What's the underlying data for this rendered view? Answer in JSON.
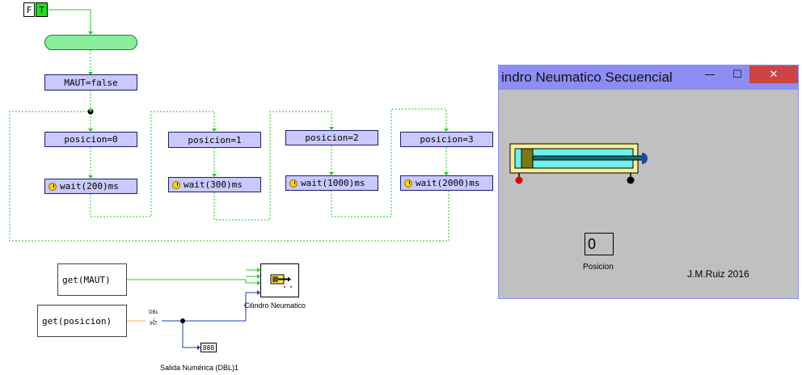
{
  "toggle": {
    "f_label": "F",
    "t_label": "T"
  },
  "flow": {
    "init_label": "MAUT=false",
    "steps": [
      {
        "set_label": "posicion=0",
        "wait_label": "wait(200)ms"
      },
      {
        "set_label": "posicion=1",
        "wait_label": "wait(300)ms"
      },
      {
        "set_label": "posicion=2",
        "wait_label": "wait(1000)ms"
      },
      {
        "set_label": "posicion=3",
        "wait_label": "wait(2000)ms"
      }
    ]
  },
  "inputs": {
    "get_maut": "get(MAUT)",
    "get_posicion": "get(posicion)",
    "converter_top": "DBL",
    "converter_bottom": "INT",
    "display_value": "888"
  },
  "labels": {
    "cylinder": "Cilindro Neumatico",
    "numeric_output": "Salida Numérica (DBL)1"
  },
  "window": {
    "title": "indro Neumatico Secuencial",
    "minimize": "—",
    "maximize": "☐",
    "close": "✕",
    "position_value": "0",
    "position_label": "Posicion",
    "credit": "J.M.Ruiz 2016"
  }
}
